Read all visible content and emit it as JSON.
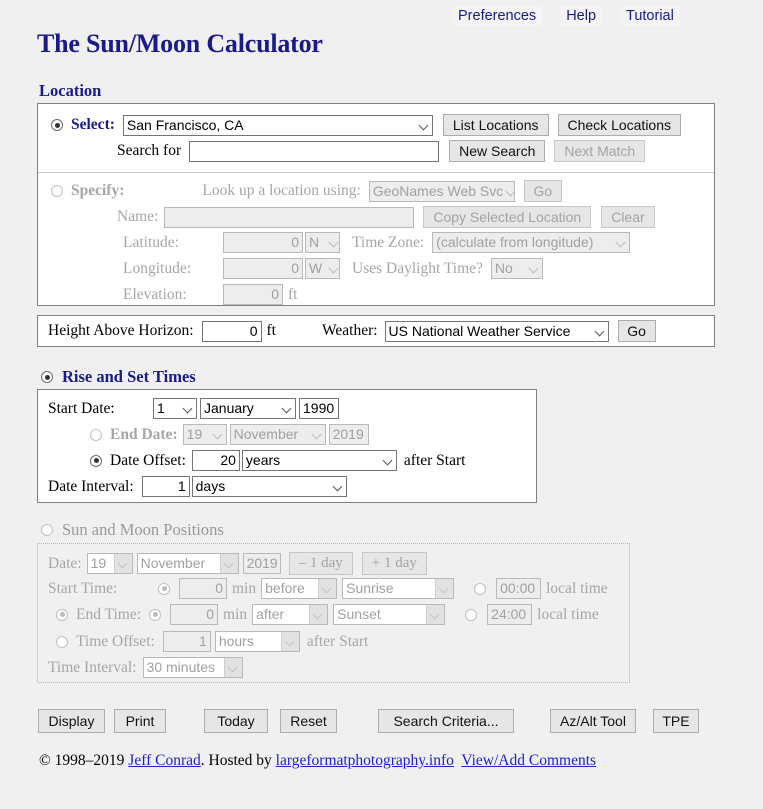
{
  "topnav": {
    "items": [
      {
        "label": "Preferences"
      },
      {
        "label": "Help"
      },
      {
        "label": "Tutorial"
      }
    ]
  },
  "page_title": "The Sun/Moon Calculator",
  "location": {
    "legend": "Location",
    "select": {
      "label": "Select:",
      "value": "San Francisco, CA",
      "list_locations_button": "List Locations",
      "check_locations_button": "Check Locations"
    },
    "search": {
      "label": "Search for",
      "value": "",
      "new_search_button": "New Search",
      "next_match_button": "Next Match"
    },
    "specify": {
      "label": "Specify:",
      "lookup_label": "Look up a location using:",
      "lookup_value": "GeoNames Web Svc",
      "go_button": "Go",
      "name_label": "Name:",
      "name_value": "",
      "copy_button": "Copy Selected Location",
      "clear_button": "Clear",
      "latitude_label": "Latitude:",
      "latitude_value": "0",
      "latitude_hemisphere": "N",
      "longitude_label": "Longitude:",
      "longitude_value": "0",
      "longitude_hemisphere": "W",
      "elevation_label": "Elevation:",
      "elevation_value": "0",
      "elevation_units": "ft",
      "timezone_label": "Time Zone:",
      "timezone_value": "(calculate from longitude)",
      "dst_label": "Uses Daylight Time?",
      "dst_value": "No"
    },
    "horizon": {
      "label": "Height Above Horizon:",
      "value": "0",
      "units": "ft",
      "weather_label": "Weather:",
      "weather_value": "US National Weather Service",
      "weather_go_button": "Go"
    }
  },
  "rise_set": {
    "legend": "Rise and Set Times",
    "selected": true,
    "start_date": {
      "label": "Start Date:",
      "day": "1",
      "month": "January",
      "year": "1990"
    },
    "end_date": {
      "label": "End Date:",
      "day": "19",
      "month": "November",
      "year": "2019"
    },
    "date_offset": {
      "label": "Date Offset:",
      "value": "20",
      "units": "years",
      "suffix": "after Start"
    },
    "date_interval": {
      "label": "Date Interval:",
      "value": "1",
      "units": "days"
    }
  },
  "positions": {
    "legend": "Sun and Moon Positions",
    "selected": false,
    "date": {
      "label": "Date:",
      "day": "19",
      "month": "November",
      "year": "2019",
      "minus_day_button": "– 1 day",
      "plus_day_button": "+ 1 day"
    },
    "start_time": {
      "label": "Start Time:",
      "value": "0",
      "units": "min",
      "relation": "before",
      "event": "Sunrise",
      "clock_value": "00:00",
      "clock_suffix": "local time"
    },
    "end_time": {
      "label": "End Time:",
      "value": "0",
      "units": "min",
      "relation": "after",
      "event": "Sunset",
      "clock_value": "24:00",
      "clock_suffix": "local time"
    },
    "time_offset": {
      "label": "Time Offset:",
      "value": "1",
      "units": "hours",
      "suffix": "after Start"
    },
    "time_interval": {
      "label": "Time Interval:",
      "value": "30 minutes"
    }
  },
  "actions": {
    "display": "Display",
    "print": "Print",
    "today": "Today",
    "reset": "Reset",
    "search_criteria": "Search Criteria...",
    "az_alt_tool": "Az/Alt Tool",
    "tpe": "TPE"
  },
  "footer": {
    "copyright": "© 1998–2019 ",
    "author": "Jeff Conrad",
    "hosted_by": ". Hosted by ",
    "host": "largeformatphotography.info",
    "comments": "View/Add Comments"
  }
}
